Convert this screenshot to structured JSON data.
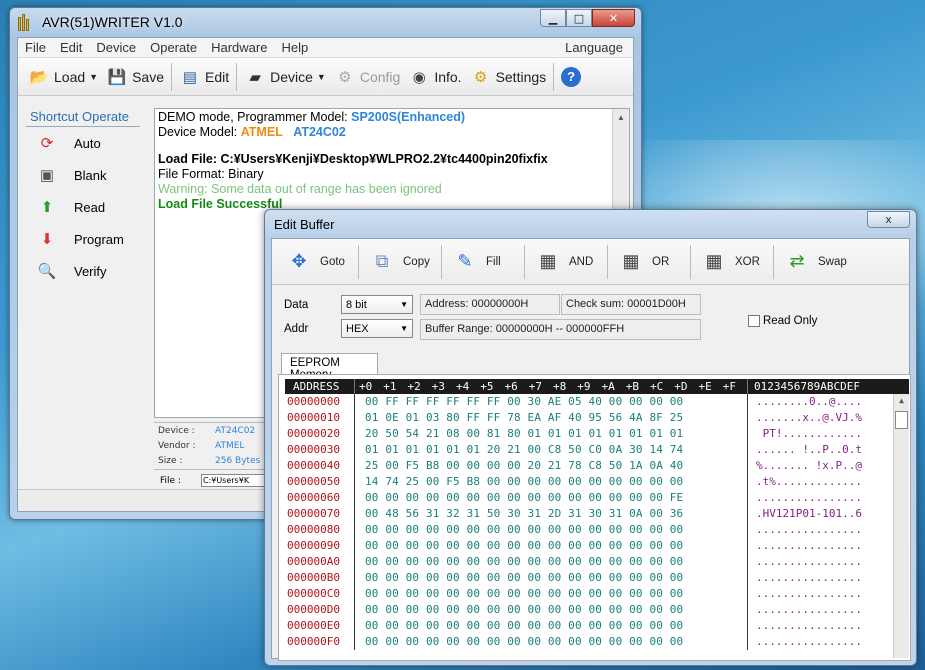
{
  "main": {
    "title": "AVR(51)WRITER V1.0",
    "menu": [
      "File",
      "Edit",
      "Device",
      "Operate",
      "Hardware",
      "Help"
    ],
    "menu_language": "Language",
    "toolbar": {
      "load": "Load",
      "save": "Save",
      "edit": "Edit",
      "device": "Device",
      "config": "Config",
      "info": "Info.",
      "settings": "Settings"
    },
    "shortcut_title": "Shortcut Operate",
    "shortcuts": [
      "Auto",
      "Blank",
      "Read",
      "Program",
      "Verify"
    ],
    "log": {
      "line1_prefix": "DEMO mode, Programmer Model: ",
      "line1_model": "SP200S(Enhanced)",
      "line2_prefix": "Device Model: ",
      "line2_vendor": "ATMEL",
      "line2_device": "AT24C02",
      "line3": " Load File: C:¥Users¥Kenji¥Desktop¥WLPRO2.2¥tc4400pin20fixfix",
      "line4": "File Format: Binary",
      "line5": "Warning: Some data out of range has been ignored",
      "line6": "Load File Successful"
    },
    "devinfo": {
      "device_label": "Device :",
      "device_value": "AT24C02",
      "vendor_label": "Vendor :",
      "vendor_value": "ATMEL",
      "size_label": "Size   :",
      "size_value": "256 Bytes",
      "file_label": "File   :",
      "file_value": "C:¥Users¥K"
    }
  },
  "edit_buffer": {
    "title": "Edit Buffer",
    "close": "x",
    "tools": [
      "Goto",
      "Copy",
      "Fill",
      "AND",
      "OR",
      "XOR",
      "Swap"
    ],
    "data_label": "Data",
    "data_value": "8 bit",
    "addr_label": "Addr",
    "addr_value": "HEX",
    "address": "Address: 00000000H",
    "checksum": "Check sum: 00001D00H",
    "range": "Buffer Range: 00000000H -- 000000FFH",
    "read_only": "Read Only",
    "tab": "EEPROM Memory",
    "hex_header": {
      "address": "ADDRESS",
      "columns": [
        "+0",
        "+1",
        "+2",
        "+3",
        "+4",
        "+5",
        "+6",
        "+7",
        "+8",
        "+9",
        "+A",
        "+B",
        "+C",
        "+D",
        "+E",
        "+F"
      ],
      "ascii": "0123456789ABCDEF"
    },
    "rows": [
      {
        "addr": "00000000",
        "bytes": "00 FF FF FF FF FF FF 00 30 AE 05 40 00 00 00 00",
        "ascii": "........0..@...."
      },
      {
        "addr": "00000010",
        "bytes": "01 0E 01 03 80 FF FF 78 EA AF 40 95 56 4A 8F 25",
        "ascii": ".......x..@.VJ.%"
      },
      {
        "addr": "00000020",
        "bytes": "20 50 54 21 08 00 81 80 01 01 01 01 01 01 01 01",
        "ascii": " PT!............"
      },
      {
        "addr": "00000030",
        "bytes": "01 01 01 01 01 01 20 21 00 C8 50 C0 0A 30 14 74",
        "ascii": "...... !..P..0.t"
      },
      {
        "addr": "00000040",
        "bytes": "25 00 F5 B8 00 00 00 00 20 21 78 C8 50 1A 0A 40",
        "ascii": "%....... !x.P..@"
      },
      {
        "addr": "00000050",
        "bytes": "14 74 25 00 F5 B8 00 00 00 00 00 00 00 00 00 00",
        ".ascii": "",
        "ascii": ".t%............."
      },
      {
        "addr": "00000060",
        "bytes": "00 00 00 00 00 00 00 00 00 00 00 00 00 00 00 FE",
        "ascii": "................"
      },
      {
        "addr": "00000070",
        "bytes": "00 48 56 31 32 31 50 30 31 2D 31 30 31 0A 00 36",
        "ascii": ".HV121P01-101..6"
      },
      {
        "addr": "00000080",
        "bytes": "00 00 00 00 00 00 00 00 00 00 00 00 00 00 00 00",
        "ascii": "................"
      },
      {
        "addr": "00000090",
        "bytes": "00 00 00 00 00 00 00 00 00 00 00 00 00 00 00 00",
        "ascii": "................"
      },
      {
        "addr": "000000A0",
        "bytes": "00 00 00 00 00 00 00 00 00 00 00 00 00 00 00 00",
        "ascii": "................"
      },
      {
        "addr": "000000B0",
        "bytes": "00 00 00 00 00 00 00 00 00 00 00 00 00 00 00 00",
        "ascii": "................"
      },
      {
        "addr": "000000C0",
        "bytes": "00 00 00 00 00 00 00 00 00 00 00 00 00 00 00 00",
        "ascii": "................"
      },
      {
        "addr": "000000D0",
        "bytes": "00 00 00 00 00 00 00 00 00 00 00 00 00 00 00 00",
        "ascii": "................"
      },
      {
        "addr": "000000E0",
        "bytes": "00 00 00 00 00 00 00 00 00 00 00 00 00 00 00 00",
        "ascii": "................"
      },
      {
        "addr": "000000F0",
        "bytes": "00 00 00 00 00 00 00 00 00 00 00 00 00 00 00 00",
        "ascii": "................"
      }
    ]
  }
}
